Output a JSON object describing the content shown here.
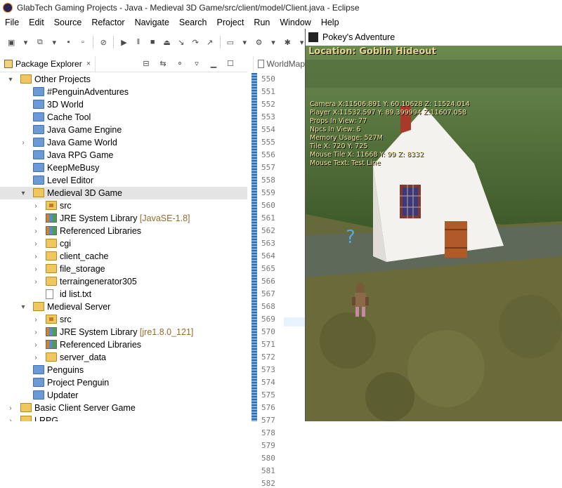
{
  "window": {
    "title": "GlabTech Gaming Projects - Java - Medieval 3D Game/src/client/model/Client.java - Eclipse"
  },
  "menu": [
    "File",
    "Edit",
    "Source",
    "Refactor",
    "Navigate",
    "Search",
    "Project",
    "Run",
    "Window",
    "Help"
  ],
  "package_explorer": {
    "tab_label": "Package Explorer",
    "close_glyph": "×",
    "tree": [
      {
        "label": "Other Projects",
        "dec": "",
        "level": 0,
        "expander": "▾",
        "icon": "working-set-icon"
      },
      {
        "label": "#PenguinAdventures",
        "dec": "",
        "level": 1,
        "expander": "",
        "icon": "project-folder-icon"
      },
      {
        "label": "3D World",
        "dec": "",
        "level": 1,
        "expander": "",
        "icon": "project-folder-icon"
      },
      {
        "label": "Cache Tool",
        "dec": "",
        "level": 1,
        "expander": "",
        "icon": "project-folder-icon"
      },
      {
        "label": "Java Game Engine",
        "dec": "",
        "level": 1,
        "expander": "",
        "icon": "project-folder-icon"
      },
      {
        "label": "Java Game World",
        "dec": "",
        "level": 1,
        "expander": "›",
        "icon": "project-folder-icon"
      },
      {
        "label": "Java RPG Game",
        "dec": "",
        "level": 1,
        "expander": "",
        "icon": "project-folder-icon"
      },
      {
        "label": "KeepMeBusy",
        "dec": "",
        "level": 1,
        "expander": "",
        "icon": "project-folder-icon"
      },
      {
        "label": "Level Editor",
        "dec": "",
        "level": 1,
        "expander": "",
        "icon": "project-folder-icon"
      },
      {
        "label": "Medieval 3D Game",
        "dec": "",
        "level": 1,
        "expander": "▾",
        "icon": "open-project-icon",
        "selected": true
      },
      {
        "label": "src",
        "dec": "",
        "level": 2,
        "expander": "›",
        "icon": "source-folder-icon"
      },
      {
        "label": "JRE System Library",
        "dec": " [JavaSE-1.8]",
        "level": 2,
        "expander": "›",
        "icon": "library-icon"
      },
      {
        "label": "Referenced Libraries",
        "dec": "",
        "level": 2,
        "expander": "›",
        "icon": "library-icon"
      },
      {
        "label": "cgi",
        "dec": "",
        "level": 2,
        "expander": "›",
        "icon": "folder-icon"
      },
      {
        "label": "client_cache",
        "dec": "",
        "level": 2,
        "expander": "›",
        "icon": "folder-icon"
      },
      {
        "label": "file_storage",
        "dec": "",
        "level": 2,
        "expander": "›",
        "icon": "folder-icon"
      },
      {
        "label": "terraingenerator305",
        "dec": "",
        "level": 2,
        "expander": "›",
        "icon": "folder-icon"
      },
      {
        "label": "id list.txt",
        "dec": "",
        "level": 2,
        "expander": "",
        "icon": "text-file-icon"
      },
      {
        "label": "Medieval Server",
        "dec": "",
        "level": 1,
        "expander": "▾",
        "icon": "open-project-icon"
      },
      {
        "label": "src",
        "dec": "",
        "level": 2,
        "expander": "›",
        "icon": "source-folder-icon"
      },
      {
        "label": "JRE System Library",
        "dec": " [jre1.8.0_121]",
        "level": 2,
        "expander": "›",
        "icon": "library-icon"
      },
      {
        "label": "Referenced Libraries",
        "dec": "",
        "level": 2,
        "expander": "›",
        "icon": "library-icon"
      },
      {
        "label": "server_data",
        "dec": "",
        "level": 2,
        "expander": "›",
        "icon": "folder-icon"
      },
      {
        "label": "Penguins",
        "dec": "",
        "level": 1,
        "expander": "",
        "icon": "project-folder-icon"
      },
      {
        "label": "Project Penguin",
        "dec": "",
        "level": 1,
        "expander": "",
        "icon": "project-folder-icon"
      },
      {
        "label": "Updater",
        "dec": "",
        "level": 1,
        "expander": "",
        "icon": "project-folder-icon"
      },
      {
        "label": "Basic Client Server Game",
        "dec": "",
        "level": 0,
        "expander": "›",
        "icon": "working-set-icon"
      },
      {
        "label": "LRPG",
        "dec": "",
        "level": 0,
        "expander": "›",
        "icon": "working-set-icon"
      }
    ]
  },
  "editor": {
    "tab_label": "WorldMap",
    "line_numbers": [
      "550",
      "551",
      "552",
      "553",
      "554",
      "555",
      "556",
      "557",
      "558",
      "559",
      "560",
      "561",
      "562",
      "563",
      "564",
      "565",
      "566",
      "567",
      "568",
      "569",
      "570",
      "571",
      "572",
      "573",
      "574",
      "575",
      "576",
      "577",
      "578",
      "579",
      "580",
      "581",
      "582"
    ]
  },
  "game": {
    "title": "Pokey's Adventure",
    "location": "Location: Goblin Hideout",
    "debug": [
      "Camera X:11506.891 Y: 60.10628 Z: 11524.014",
      "Player X:11532.597 Y: 89.399994 Z:11607.058",
      "Props In View: 77",
      "Npcs In View: 6",
      "Memory Usage: 527M",
      "Tile X: 720 Y: 725",
      "Mouse Tile X: 11668 Y: 99 Z: 8332",
      "Mouse Text: Test Line"
    ],
    "npc_indicator": "?",
    "hud_color": "#f3e39a"
  }
}
